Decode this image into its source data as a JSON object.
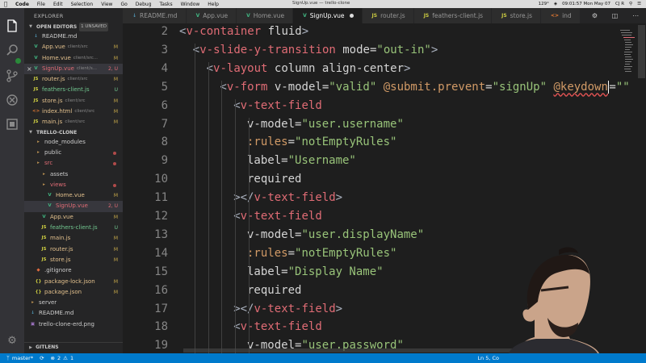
{
  "menubar": {
    "apple": "",
    "items": [
      "Code",
      "File",
      "Edit",
      "Selection",
      "View",
      "Go",
      "Debug",
      "Tasks",
      "Window",
      "Help"
    ],
    "window_title": "SignUp.vue — trello-clone",
    "clock": "09:01:57 Mon May 07",
    "user": "CJ R",
    "battery": "129°"
  },
  "sidebar": {
    "title": "EXPLORER",
    "open_editors": {
      "label": "OPEN EDITORS",
      "badge": "1 UNSAVED"
    },
    "open_files": [
      {
        "icon": "md",
        "name": "README.md",
        "sub": "",
        "status": "",
        "style": ""
      },
      {
        "icon": "vue",
        "name": "App.vue",
        "sub": "client/src",
        "status": "M",
        "style": "mod"
      },
      {
        "icon": "vue",
        "name": "Home.vue",
        "sub": "client/src...",
        "status": "M",
        "style": "mod"
      },
      {
        "icon": "vue",
        "name": "SignUp.vue",
        "sub": "client/s...",
        "status": "2, U",
        "style": "err",
        "selected": true
      },
      {
        "icon": "js",
        "name": "router.js",
        "sub": "client/src",
        "status": "M",
        "style": "mod"
      },
      {
        "icon": "js",
        "name": "feathers-client.js",
        "sub": "",
        "status": "U",
        "style": "untr"
      },
      {
        "icon": "js",
        "name": "store.js",
        "sub": "client/src",
        "status": "M",
        "style": "mod"
      },
      {
        "icon": "html",
        "name": "index.html",
        "sub": "client/src",
        "status": "M",
        "style": "mod"
      },
      {
        "icon": "js",
        "name": "main.js",
        "sub": "client/src",
        "status": "M",
        "style": "mod"
      }
    ],
    "project": {
      "label": "TRELLO-CLONE"
    },
    "tree": [
      {
        "depth": 1,
        "icon": "fold",
        "name": "node_modules",
        "status": "",
        "style": ""
      },
      {
        "depth": 1,
        "icon": "fold",
        "name": "public",
        "status": "",
        "style": "",
        "dot": true
      },
      {
        "depth": 1,
        "icon": "fold",
        "name": "src",
        "status": "",
        "style": "err",
        "dot": true
      },
      {
        "depth": 2,
        "icon": "fold",
        "name": "assets",
        "status": "",
        "style": ""
      },
      {
        "depth": 2,
        "icon": "fold",
        "name": "views",
        "status": "",
        "style": "err",
        "dot": true
      },
      {
        "depth": 3,
        "icon": "vue",
        "name": "Home.vue",
        "status": "M",
        "style": "mod"
      },
      {
        "depth": 3,
        "icon": "vue",
        "name": "SignUp.vue",
        "status": "2, U",
        "style": "err",
        "selected": true
      },
      {
        "depth": 2,
        "icon": "vue",
        "name": "App.vue",
        "status": "M",
        "style": "mod"
      },
      {
        "depth": 2,
        "icon": "js",
        "name": "feathers-client.js",
        "status": "U",
        "style": "untr"
      },
      {
        "depth": 2,
        "icon": "js",
        "name": "main.js",
        "status": "M",
        "style": "mod"
      },
      {
        "depth": 2,
        "icon": "js",
        "name": "router.js",
        "status": "M",
        "style": "mod"
      },
      {
        "depth": 2,
        "icon": "js",
        "name": "store.js",
        "status": "M",
        "style": "mod"
      },
      {
        "depth": 1,
        "icon": "git",
        "name": ".gitignore",
        "status": "",
        "style": ""
      },
      {
        "depth": 1,
        "icon": "json",
        "name": "package-lock.json",
        "status": "M",
        "style": "mod"
      },
      {
        "depth": 1,
        "icon": "json",
        "name": "package.json",
        "status": "M",
        "style": "mod"
      },
      {
        "depth": 0,
        "icon": "fold",
        "name": "server",
        "status": "",
        "style": ""
      },
      {
        "depth": 0,
        "icon": "md",
        "name": "README.md",
        "status": "",
        "style": ""
      },
      {
        "depth": 0,
        "icon": "img",
        "name": "trello-clone-erd.png",
        "status": "",
        "style": ""
      }
    ],
    "gitlens": "GITLENS"
  },
  "tabs": [
    {
      "icon": "md",
      "label": "README.md"
    },
    {
      "icon": "vue",
      "label": "App.vue"
    },
    {
      "icon": "vue",
      "label": "Home.vue"
    },
    {
      "icon": "vue",
      "label": "SignUp.vue",
      "active": true,
      "dirty": true
    },
    {
      "icon": "js",
      "label": "router.js"
    },
    {
      "icon": "js",
      "label": "feathers-client.js"
    },
    {
      "icon": "js",
      "label": "store.js"
    },
    {
      "icon": "html",
      "label": "ind"
    }
  ],
  "editor": {
    "lines": [
      {
        "n": "2",
        "segs": [
          [
            "br",
            "<"
          ],
          [
            "tag",
            "v-container"
          ],
          [
            "plain",
            " fluid"
          ],
          [
            "br",
            ">"
          ]
        ],
        "indent": 0
      },
      {
        "n": "3",
        "segs": [
          [
            "br",
            "<"
          ],
          [
            "tag",
            "v-slide-y-transition"
          ],
          [
            "plain",
            " mode="
          ],
          [
            "str",
            "\"out-in\""
          ],
          [
            "br",
            ">"
          ]
        ],
        "indent": 1
      },
      {
        "n": "4",
        "segs": [
          [
            "br",
            "<"
          ],
          [
            "tag",
            "v-layout"
          ],
          [
            "plain",
            " column align-center"
          ],
          [
            "br",
            ">"
          ]
        ],
        "indent": 2
      },
      {
        "n": "5",
        "segs": [
          [
            "br",
            "<"
          ],
          [
            "tag",
            "v-form"
          ],
          [
            "plain",
            " v-model="
          ],
          [
            "str",
            "\"valid\""
          ],
          [
            "plain",
            " "
          ],
          [
            "attr",
            "@submit.prevent"
          ],
          [
            "plain",
            "="
          ],
          [
            "str",
            "\"signUp\""
          ],
          [
            "plain",
            " "
          ],
          [
            "squig",
            "@keydown"
          ],
          [
            "cursor",
            ""
          ],
          [
            "plain",
            "="
          ],
          [
            "str",
            "\"\""
          ]
        ],
        "indent": 3
      },
      {
        "n": "6",
        "segs": [
          [
            "br",
            "<"
          ],
          [
            "tag",
            "v-text-field"
          ]
        ],
        "indent": 4
      },
      {
        "n": "7",
        "segs": [
          [
            "plain",
            "v-model="
          ],
          [
            "str",
            "\"user.username\""
          ]
        ],
        "indent": 5
      },
      {
        "n": "8",
        "segs": [
          [
            "attr",
            ":rules"
          ],
          [
            "plain",
            "="
          ],
          [
            "str",
            "\"notEmptyRules\""
          ]
        ],
        "indent": 5
      },
      {
        "n": "9",
        "segs": [
          [
            "plain",
            "label="
          ],
          [
            "str",
            "\"Username\""
          ]
        ],
        "indent": 5
      },
      {
        "n": "10",
        "segs": [
          [
            "plain",
            "required"
          ]
        ],
        "indent": 5
      },
      {
        "n": "11",
        "segs": [
          [
            "br",
            "></"
          ],
          [
            "tag",
            "v-text-field"
          ],
          [
            "br",
            ">"
          ]
        ],
        "indent": 4
      },
      {
        "n": "12",
        "segs": [
          [
            "br",
            "<"
          ],
          [
            "tag",
            "v-text-field"
          ]
        ],
        "indent": 4
      },
      {
        "n": "13",
        "segs": [
          [
            "plain",
            "v-model="
          ],
          [
            "str",
            "\"user.displayName\""
          ]
        ],
        "indent": 5
      },
      {
        "n": "14",
        "segs": [
          [
            "attr",
            ":rules"
          ],
          [
            "plain",
            "="
          ],
          [
            "str",
            "\"notEmptyRules\""
          ]
        ],
        "indent": 5
      },
      {
        "n": "15",
        "segs": [
          [
            "plain",
            "label="
          ],
          [
            "str",
            "\"Display Name\""
          ]
        ],
        "indent": 5
      },
      {
        "n": "16",
        "segs": [
          [
            "plain",
            "required"
          ]
        ],
        "indent": 5
      },
      {
        "n": "17",
        "segs": [
          [
            "br",
            "></"
          ],
          [
            "tag",
            "v-text-field"
          ],
          [
            "br",
            ">"
          ]
        ],
        "indent": 4
      },
      {
        "n": "18",
        "segs": [
          [
            "br",
            "<"
          ],
          [
            "tag",
            "v-text-field"
          ]
        ],
        "indent": 4
      },
      {
        "n": "19",
        "segs": [
          [
            "plain",
            "v-model="
          ],
          [
            "str",
            "\"user.password\""
          ]
        ],
        "indent": 5
      }
    ]
  },
  "status": {
    "branch": "master*",
    "sync": "",
    "errors": "2",
    "warnings": "1",
    "cursor_pos": "Ln 5, Co"
  },
  "colors": {
    "accent": "#007acc",
    "tag": "#e06c75",
    "string": "#98c379",
    "attr": "#d19a66"
  }
}
